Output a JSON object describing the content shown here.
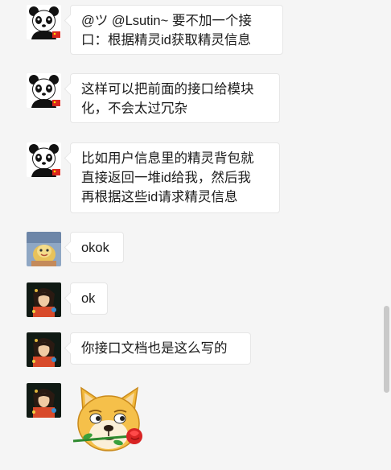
{
  "messages": [
    {
      "avatar": "panda-avatar",
      "text": "@ツ @Lsutin~ 要不加一个接口：根据精灵id获取精灵信息",
      "line1": "@ツ @Lsutin~ 要不加一个接",
      "line2": "口：根据精灵id获取精灵信息"
    },
    {
      "avatar": "panda-avatar",
      "line1": "这样可以把前面的接口给模块",
      "line2": "化，不会太过冗杂"
    },
    {
      "avatar": "panda-avatar",
      "line1": "比如用户信息里的精灵背包就",
      "line2": "直接返回一堆id给我，然后我",
      "line3": "再根据这些id请求精灵信息"
    },
    {
      "avatar": "cartoon-avatar",
      "text": "okok"
    },
    {
      "avatar": "anime-avatar",
      "text": "ok"
    },
    {
      "avatar": "anime-avatar",
      "text": "你接口文档也是这么写的"
    },
    {
      "avatar": "anime-avatar",
      "sticker": "doge-with-rose-sticker"
    }
  ],
  "colors": {
    "background": "#f5f5f5",
    "bubble": "#ffffff",
    "border": "#e6e6e6"
  }
}
